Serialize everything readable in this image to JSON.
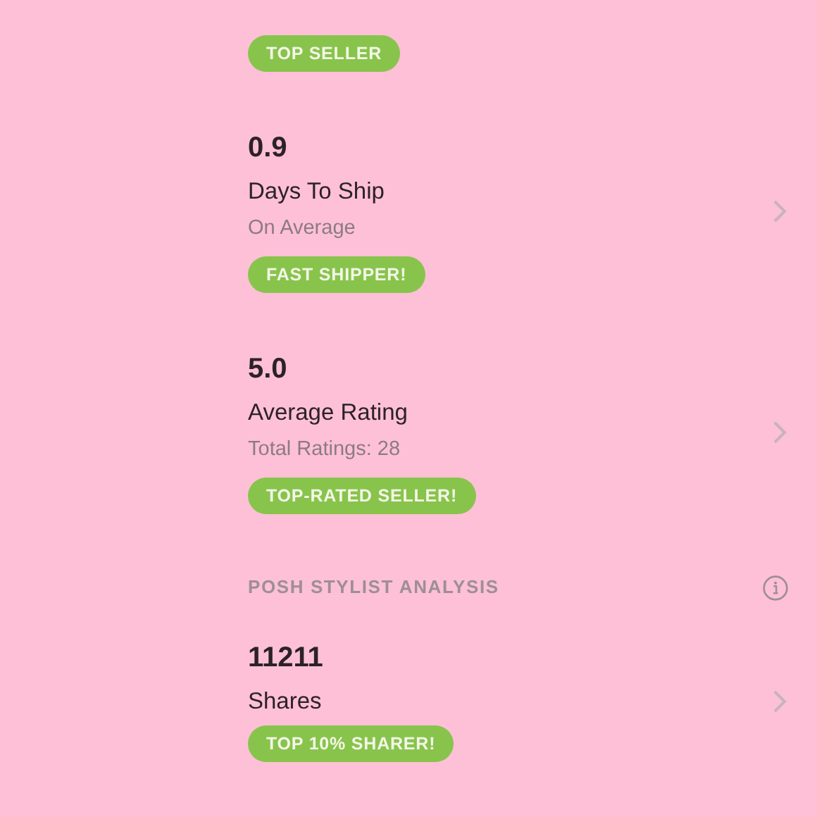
{
  "items": [
    {
      "kind": "badge",
      "badge": "TOP SELLER"
    },
    {
      "kind": "stat",
      "value": "0.9",
      "label": "Days To Ship",
      "sub": "On Average",
      "badge": "FAST SHIPPER!"
    },
    {
      "kind": "stat",
      "value": "5.0",
      "label": "Average Rating",
      "sub": "Total Ratings: 28",
      "badge": "TOP-RATED SELLER!"
    },
    {
      "kind": "section",
      "title": "POSH STYLIST ANALYSIS"
    },
    {
      "kind": "stat",
      "value": "11211",
      "label": "Shares",
      "badge": "TOP 10% SHARER!"
    }
  ]
}
